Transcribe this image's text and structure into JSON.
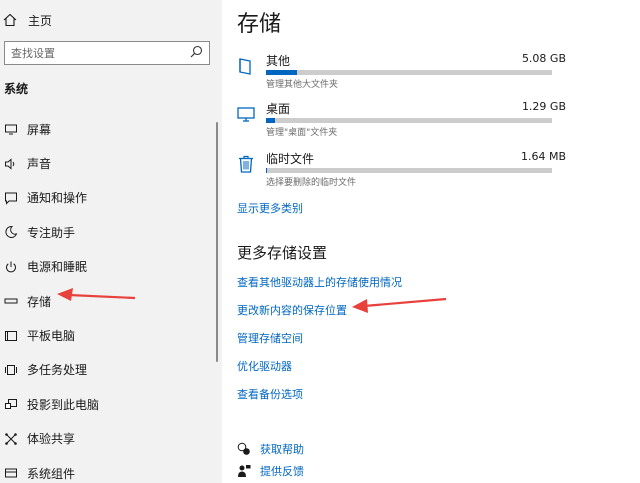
{
  "sidebar": {
    "home_label": "主页",
    "search_placeholder": "查找设置",
    "section_title": "系统",
    "items": [
      {
        "label": "屏幕",
        "icon": "monitor-icon"
      },
      {
        "label": "声音",
        "icon": "speaker-icon"
      },
      {
        "label": "通知和操作",
        "icon": "notification-icon"
      },
      {
        "label": "专注助手",
        "icon": "moon-icon"
      },
      {
        "label": "电源和睡眠",
        "icon": "power-icon"
      },
      {
        "label": "存储",
        "icon": "storage-drive-icon",
        "selected": true
      },
      {
        "label": "平板电脑",
        "icon": "tablet-icon"
      },
      {
        "label": "多任务处理",
        "icon": "multitask-icon"
      },
      {
        "label": "投影到此电脑",
        "icon": "project-icon"
      },
      {
        "label": "体验共享",
        "icon": "share-icon"
      },
      {
        "label": "系统组件",
        "icon": "components-icon"
      }
    ]
  },
  "main": {
    "title": "存储",
    "storage_items": [
      {
        "name": "其他",
        "size": "5.08 GB",
        "subtitle": "管理其他大文件夹",
        "usage": 0.11,
        "icon": "folder-icon"
      },
      {
        "name": "桌面",
        "size": "1.29 GB",
        "subtitle": "管理\"桌面\"文件夹",
        "usage": 0.03,
        "icon": "desktop-icon"
      },
      {
        "name": "临时文件",
        "size": "1.64 MB",
        "subtitle": "选择要删除的临时文件",
        "usage": 0.0,
        "icon": "trash-icon"
      }
    ],
    "show_more": "显示更多类别",
    "more_settings_title": "更多存储设置",
    "links": [
      "查看其他驱动器上的存储使用情况",
      "更改新内容的保存位置",
      "管理存储空间",
      "优化驱动器",
      "查看备份选项"
    ],
    "help": [
      {
        "label": "获取帮助",
        "icon": "help-chat-icon"
      },
      {
        "label": "提供反馈",
        "icon": "feedback-icon"
      }
    ]
  },
  "colors": {
    "accent": "#0067c0",
    "annotation_arrow": "#e8413c",
    "sidebar_bg": "#f2f2f2"
  }
}
